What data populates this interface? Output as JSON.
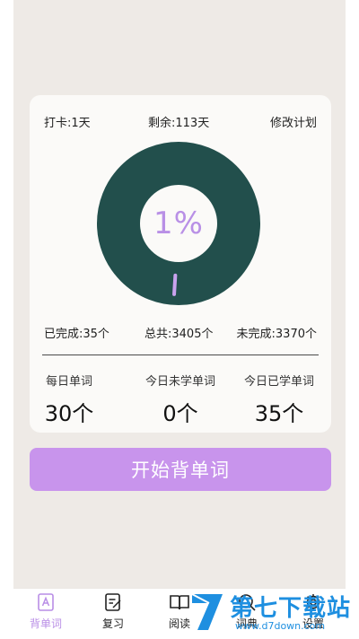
{
  "plan": {
    "checkin_label": "打卡:1天",
    "remaining_label": "剩余:113天",
    "edit_plan_label": "修改计划"
  },
  "progress": {
    "percent_text": "1%",
    "fraction": 0.01,
    "ring_color": "#224f4c",
    "marker_color": "#c9a2ee"
  },
  "stats": {
    "completed": "已完成:35个",
    "total": "总共:3405个",
    "incomplete": "未完成:3370个"
  },
  "daily": [
    {
      "label": "每日单词",
      "value": "30个"
    },
    {
      "label": "今日未学单词",
      "value": "0个"
    },
    {
      "label": "今日已学单词",
      "value": "35个"
    }
  ],
  "start_button": {
    "label": "开始背单词",
    "color": "#c894ec"
  },
  "tabs": [
    {
      "label": "背单词",
      "icon": "book-a-icon",
      "active": true
    },
    {
      "label": "复习",
      "icon": "review-notes-icon",
      "active": false
    },
    {
      "label": "阅读",
      "icon": "open-book-icon",
      "active": false
    },
    {
      "label": "词典",
      "icon": "search-icon",
      "active": false
    },
    {
      "label": "设置",
      "icon": "gear-icon",
      "active": false
    }
  ],
  "watermark": {
    "title": "第七下载站",
    "url": "www.d7down.com"
  },
  "colors": {
    "accent": "#b98ee6",
    "background": "#eeeae6",
    "card": "#fbfaf8"
  }
}
